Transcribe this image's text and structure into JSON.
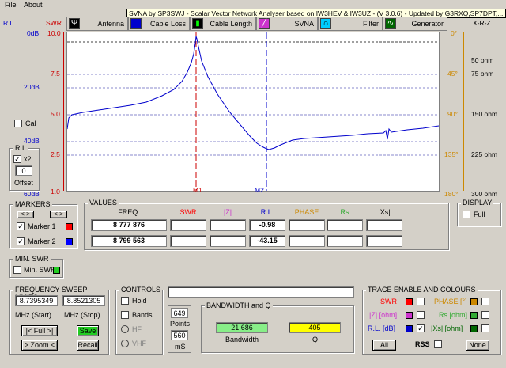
{
  "menu": {
    "file": "File",
    "about": "About"
  },
  "title": "SVNA by SP3SWJ -  Scalar Vector Network Analyser based on IW3HEV & IW3UZ - (V 3.0.6) - Updated by G3RXQ,SP7DPT,...",
  "tabs": [
    {
      "label": "Antenna"
    },
    {
      "label": "Cable Loss"
    },
    {
      "label": "Cable Length"
    },
    {
      "label": "SVNA"
    },
    {
      "label": "Filter"
    },
    {
      "label": "Generator"
    }
  ],
  "axes": {
    "rl_title": "R.L",
    "swr_title": "SWR",
    "xrz_title": "X-R-Z",
    "rl_ticks": [
      "0dB",
      "20dB",
      "40dB",
      "60dB"
    ],
    "swr_ticks": [
      "10.0",
      "7.5",
      "5.0",
      "2.5",
      "1.0"
    ],
    "phase_ticks": [
      "0°",
      "45°",
      "90°",
      "135°",
      "180°"
    ],
    "ohm_ticks": [
      "50 ohm",
      "75 ohm",
      "150 ohm",
      "225 ohm",
      "300 ohm"
    ]
  },
  "markers_on_plot": {
    "m1": "M1",
    "m2": "M2"
  },
  "cal": {
    "label": "Cal"
  },
  "rl_panel": {
    "title": "R.L",
    "x2": "x2",
    "offset_value": "0",
    "offset_label": "Offset"
  },
  "markers": {
    "title": "MARKERS",
    "marker1": "Marker 1",
    "marker2": "Marker 2",
    "color1": "#ff0000",
    "color2": "#0000ff"
  },
  "values": {
    "title": "VALUES",
    "headers": [
      "FREQ.",
      "SWR",
      "|Z|",
      "R.L.",
      "PHASE",
      "Rs",
      "|Xs|"
    ],
    "header_colors": [
      "#000000",
      "#ff0000",
      "#cc33cc",
      "#0000cc",
      "#cc8800",
      "#33aa33",
      "#000000"
    ],
    "rows": [
      [
        "8 777 876",
        "",
        "",
        "-0.98",
        "",
        "",
        ""
      ],
      [
        "8 799 563",
        "",
        "",
        "-43.15",
        "",
        "",
        ""
      ]
    ]
  },
  "display": {
    "title": "DISPLAY",
    "full": "Full"
  },
  "min_swr": {
    "title": "MIN. SWR",
    "label": "Min. SWR"
  },
  "sweep": {
    "title": "FREQUENCY SWEEP LIMITS",
    "start": "8.7395349",
    "stop": "8.8521305",
    "start_label": "MHz (Start)",
    "stop_label": "MHz (Stop)",
    "full_btn": "|< Full >|",
    "zoom_btn": "> Zoom <",
    "save_btn": "Save",
    "recall_btn": "Recall"
  },
  "controls": {
    "title": "CONTROLS",
    "hold": "Hold",
    "bands": "Bands",
    "hf": "HF",
    "vhf": "VHF",
    "points_value": "649",
    "points_label": "Points",
    "ms_value": "560",
    "ms_label": "mS"
  },
  "bandwidth": {
    "title": "BANDWIDTH and Q",
    "bw_value": "21 686",
    "bw_label": "Bandwidth",
    "q_value": "405",
    "q_label": "Q"
  },
  "trace": {
    "title": "TRACE ENABLE AND COLOURS",
    "swr": "SWR",
    "zmag": "|Z| [ohm]",
    "rl": "R.L. [dB]",
    "phase": "PHASE [°]",
    "rs": "Rs [ohm]",
    "xs": "|Xs| [ohm]",
    "all": "All",
    "rss": "RSS",
    "none": "None",
    "colors": {
      "swr": "#ff0000",
      "zmag": "#cc33cc",
      "rl": "#0000cc",
      "phase": "#cc8800",
      "rs": "#33aa33",
      "xs": "#006600"
    }
  }
}
